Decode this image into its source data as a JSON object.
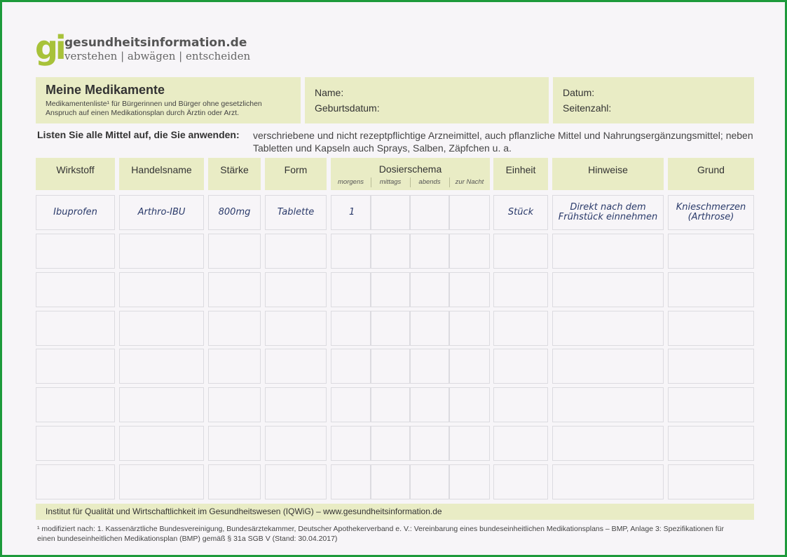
{
  "logo": {
    "mark": "gi",
    "name": "gesundheitsinformation.de",
    "tagline": "verstehen | abwägen | entscheiden"
  },
  "title_box": {
    "title": "Meine Medikamente",
    "description": "Medikamentenliste¹ für Bürgerinnen und Bürger ohne gesetzlichen Anspruch auf einen Medikationsplan durch Ärztin oder Arzt."
  },
  "person_box": {
    "name_label": "Name:",
    "birthdate_label": "Geburtsdatum:"
  },
  "date_box": {
    "date_label": "Datum:",
    "pages_label": "Seitenzahl:"
  },
  "instruction": {
    "label": "Listen Sie alle Mittel auf, die Sie anwenden:",
    "text": "verschriebene und nicht rezeptpflichtige Arzneimittel, auch pflanzliche Mittel und Nahrungsergänzungsmittel; neben Tabletten und Kapseln auch Sprays, Salben, Zäpfchen u. a."
  },
  "table": {
    "headers": {
      "wirkstoff": "Wirkstoff",
      "handelsname": "Handelsname",
      "staerke": "Stärke",
      "form": "Form",
      "dosierschema": "Dosierschema",
      "morgens": "morgens",
      "mittags": "mittags",
      "abends": "abends",
      "zur_nacht": "zur Nacht",
      "einheit": "Einheit",
      "hinweise": "Hinweise",
      "grund": "Grund"
    },
    "example_row": {
      "wirkstoff": "Ibuprofen",
      "handelsname": "Arthro-IBU",
      "staerke": "800mg",
      "form": "Tablette",
      "morgens": "1",
      "mittags": "",
      "abends": "",
      "zur_nacht": "",
      "einheit": "Stück",
      "hinweise_1": "Direkt nach dem",
      "hinweise_2": "Frühstück einnehmen",
      "grund_1": "Knieschmerzen",
      "grund_2": "(Arthrose)"
    }
  },
  "footer": {
    "institute": "Institut für Qualität und Wirtschaftlichkeit im Gesundheitswesen (IQWiG)  –  www.gesundheitsinformation.de"
  },
  "footnote": "¹ modifiziert nach: 1. Kassenärztliche Bundesvereinigung, Bundesärztekammer, Deutscher Apothekerverband e. V.: Vereinbarung eines bundeseinheitlichen Medikationsplans – BMP, Anlage 3: Spezifikationen für einen bundeseinheitlichen Medikationsplan (BMP) gemäß § 31a SGB V (Stand: 30.04.2017)"
}
